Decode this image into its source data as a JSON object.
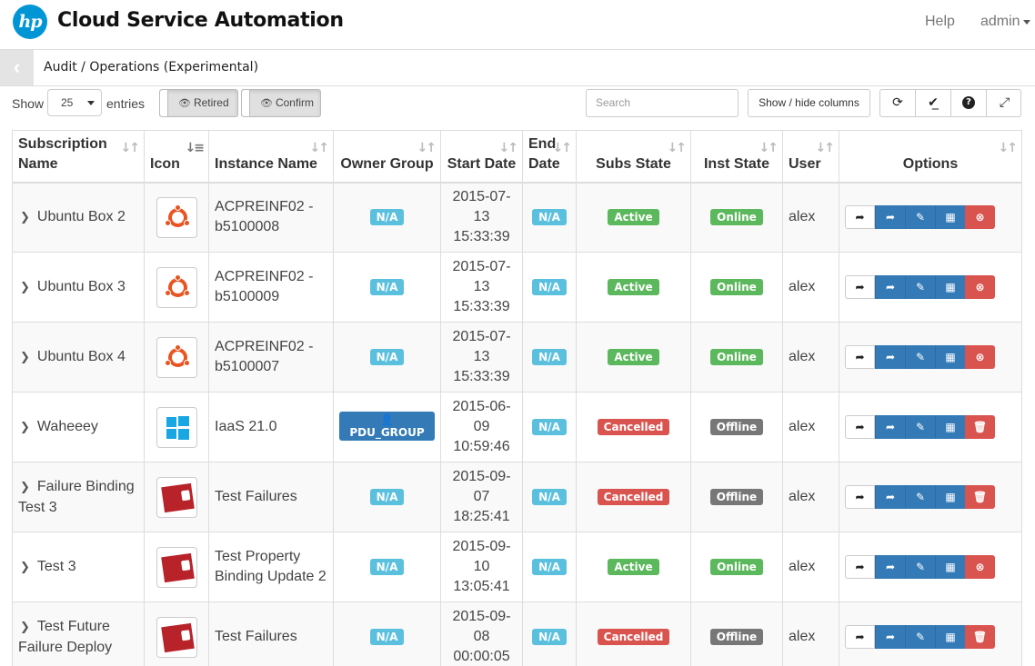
{
  "header": {
    "logo_text": "hp",
    "app_title": "Cloud Service Automation",
    "help": "Help",
    "user": "admin"
  },
  "breadcrumb": {
    "back_icon": "chevron-left-icon",
    "text": "Audit / Operations (Experimental)"
  },
  "toolbar": {
    "show_label": "Show",
    "page_size": "25",
    "entries_label": "entries",
    "retired": "Retired",
    "confirm": "Confirm",
    "search_placeholder": "Search",
    "columns_button": "Show / hide columns",
    "icons": [
      "refresh-icon",
      "check-all-icon",
      "help-icon",
      "fullscreen-icon"
    ]
  },
  "table": {
    "headers": {
      "subscription_name": "Subscription Name",
      "icon": "Icon",
      "instance_name": "Instance Name",
      "owner_group": "Owner Group",
      "start_date": "Start Date",
      "end_date": "End Date",
      "subs_state": "Subs State",
      "inst_state": "Inst State",
      "user": "User",
      "options": "Options"
    },
    "rows": [
      {
        "name": "Ubuntu Box 2",
        "icon": "ubuntu",
        "instance": "ACPREINF02 - b5100008",
        "owner": "N/A",
        "start": "2015-07-13 15:33:39",
        "end": "N/A",
        "subs_state": "Active",
        "inst_state": "Online",
        "user": "alex",
        "last_action": "cancel"
      },
      {
        "name": "Ubuntu Box 3",
        "icon": "ubuntu",
        "instance": "ACPREINF02 - b5100009",
        "owner": "N/A",
        "start": "2015-07-13 15:33:39",
        "end": "N/A",
        "subs_state": "Active",
        "inst_state": "Online",
        "user": "alex",
        "last_action": "cancel"
      },
      {
        "name": "Ubuntu Box 4",
        "icon": "ubuntu",
        "instance": "ACPREINF02 - b5100007",
        "owner": "N/A",
        "start": "2015-07-13 15:33:39",
        "end": "N/A",
        "subs_state": "Active",
        "inst_state": "Online",
        "user": "alex",
        "last_action": "cancel"
      },
      {
        "name": "Waheeey",
        "icon": "windows",
        "instance": "IaaS 21.0",
        "owner": "PDU_GROUP",
        "start": "2015-06-09 10:59:46",
        "end": "N/A",
        "subs_state": "Cancelled",
        "inst_state": "Offline",
        "user": "alex",
        "last_action": "delete"
      },
      {
        "name": "Failure Binding Test 3",
        "icon": "epic-fail",
        "instance": "Test Failures",
        "owner": "N/A",
        "start": "2015-09-07 18:25:41",
        "end": "N/A",
        "subs_state": "Cancelled",
        "inst_state": "Offline",
        "user": "alex",
        "last_action": "delete"
      },
      {
        "name": "Test 3",
        "icon": "epic-fail",
        "instance": "Test Property Binding Update 2",
        "owner": "N/A",
        "start": "2015-09-10 13:05:41",
        "end": "N/A",
        "subs_state": "Active",
        "inst_state": "Online",
        "user": "alex",
        "last_action": "cancel"
      },
      {
        "name": "Test Future Failure Deploy",
        "icon": "epic-fail",
        "instance": "Test Failures",
        "owner": "N/A",
        "start": "2015-09-08 00:00:05",
        "end": "N/A",
        "subs_state": "Cancelled",
        "inst_state": "Offline",
        "user": "alex",
        "last_action": "delete"
      }
    ]
  },
  "epic_fail_text": "EPIC FAIL",
  "colors": {
    "brand": "#0096d6",
    "info": "#5bc0de",
    "primary": "#337ab7",
    "success": "#5cb85c",
    "danger": "#d9534f",
    "default": "#777777"
  }
}
